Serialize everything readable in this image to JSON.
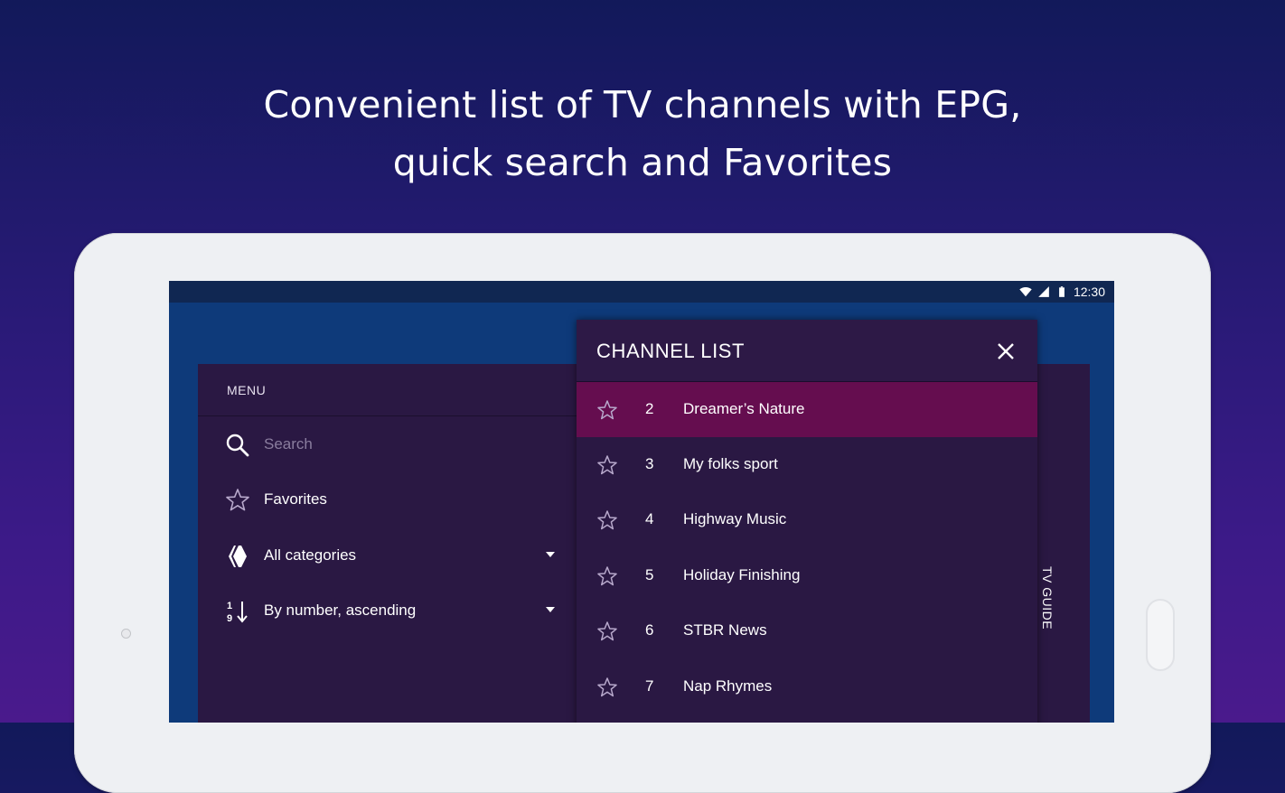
{
  "headline": {
    "line1": "Convenient list of TV channels with EPG,",
    "line2": "quick search and Favorites"
  },
  "status_bar": {
    "time": "12:30"
  },
  "menu": {
    "title": "MENU",
    "search_placeholder": "Search",
    "favorites_label": "Favorites",
    "category_label": "All categories",
    "sort_label": "By number, ascending"
  },
  "channel_list": {
    "title": "CHANNEL LIST",
    "channels": [
      {
        "number": "2",
        "name": "Dreamer’s Nature",
        "selected": true
      },
      {
        "number": "3",
        "name": "My folks sport",
        "selected": false
      },
      {
        "number": "4",
        "name": "Highway Music",
        "selected": false
      },
      {
        "number": "5",
        "name": "Holiday Finishing",
        "selected": false
      },
      {
        "number": "6",
        "name": "STBR News",
        "selected": false
      },
      {
        "number": "7",
        "name": "Nap Rhymes",
        "selected": false
      }
    ]
  },
  "tv_guide_label": "TV GUIDE",
  "colors": {
    "selected_row": "#650d4f",
    "panel_bg": "#2a1843",
    "screen_bg": "#0e3a7a"
  }
}
